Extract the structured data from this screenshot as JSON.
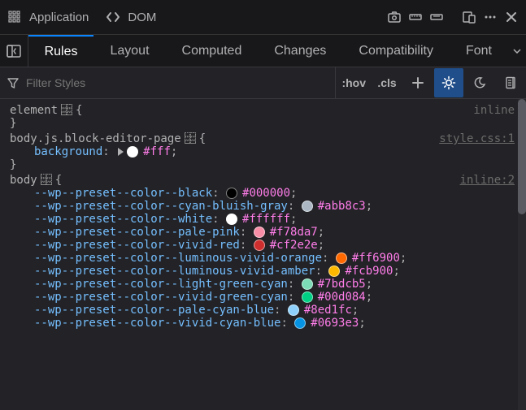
{
  "topbar": {
    "tool_app": "Application",
    "tool_dom": "DOM"
  },
  "tabs": {
    "items": [
      "Rules",
      "Layout",
      "Computed",
      "Changes",
      "Compatibility",
      "Font"
    ],
    "active_index": 0
  },
  "filter": {
    "placeholder": "Filter Styles",
    "hov": ":hov",
    "cls": ".cls"
  },
  "rules": [
    {
      "selector": "element",
      "has_grid_icon": true,
      "source": "inline",
      "source_link": false,
      "declarations": []
    },
    {
      "selector": "body.js.block-editor-page",
      "has_grid_icon": true,
      "source": "style.css:1",
      "source_link": true,
      "declarations": [
        {
          "prop": "background",
          "expand": true,
          "color": "#ffffff",
          "value": "#fff"
        }
      ]
    },
    {
      "selector": "body",
      "has_grid_icon": true,
      "source": "inline:2",
      "source_link": true,
      "declarations": [
        {
          "prop": "--wp--preset--color--black",
          "color": "#000000",
          "value": "#000000"
        },
        {
          "prop": "--wp--preset--color--cyan-bluish-gray",
          "color": "#abb8c3",
          "value": "#abb8c3"
        },
        {
          "prop": "--wp--preset--color--white",
          "color": "#ffffff",
          "value": "#ffffff"
        },
        {
          "prop": "--wp--preset--color--pale-pink",
          "color": "#f78da7",
          "value": "#f78da7"
        },
        {
          "prop": "--wp--preset--color--vivid-red",
          "color": "#cf2e2e",
          "value": "#cf2e2e"
        },
        {
          "prop": "--wp--preset--color--luminous-vivid-orange",
          "color": "#ff6900",
          "value": "#ff6900"
        },
        {
          "prop": "--wp--preset--color--luminous-vivid-amber",
          "color": "#fcb900",
          "value": "#fcb900"
        },
        {
          "prop": "--wp--preset--color--light-green-cyan",
          "color": "#7bdcb5",
          "value": "#7bdcb5"
        },
        {
          "prop": "--wp--preset--color--vivid-green-cyan",
          "color": "#00d084",
          "value": "#00d084"
        },
        {
          "prop": "--wp--preset--color--pale-cyan-blue",
          "color": "#8ed1fc",
          "value": "#8ed1fc"
        },
        {
          "prop": "--wp--preset--color--vivid-cyan-blue",
          "color": "#0693e3",
          "value": "#0693e3"
        }
      ],
      "open": true
    }
  ]
}
